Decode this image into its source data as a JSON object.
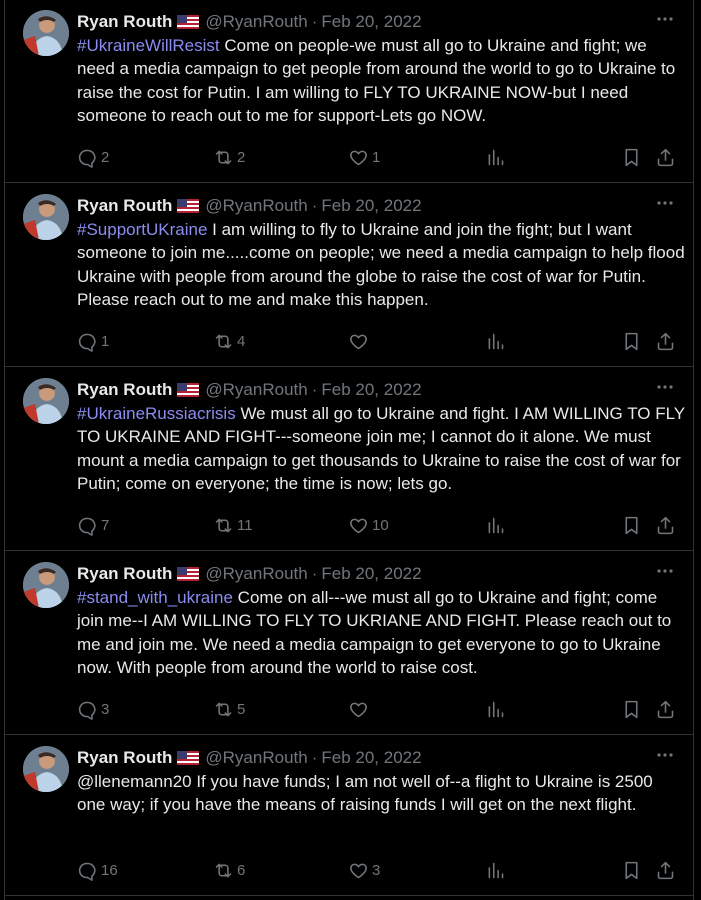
{
  "colors": {
    "background": "#000000",
    "text": "#e7e9ea",
    "muted": "#71767b",
    "hashtag": "#8b8cf0",
    "divider": "#2f3336"
  },
  "tweets": [
    {
      "name": "Ryan Routh",
      "handle": "@RyanRouth",
      "separator": "·",
      "date": "Feb 20, 2022",
      "hashtag": "#UkraineWillResist",
      "text": " Come on people-we must all go to Ukraine and fight; we need a media campaign to get people from around the world to go to Ukraine to raise the cost for Putin. I am willing to FLY TO UKRAINE NOW-but I need someone to reach out to me for support-Lets go NOW.",
      "replies": "2",
      "retweets": "2",
      "likes": "1"
    },
    {
      "name": "Ryan Routh",
      "handle": "@RyanRouth",
      "separator": "·",
      "date": "Feb 20, 2022",
      "hashtag": "#SupportUKraine",
      "text": " I am willing to fly to Ukraine and join the fight; but I want someone to join me.....come on people; we need a media campaign to help flood Ukraine with people from around the globe to raise the cost of war for Putin.  Please reach out to me and make this happen.",
      "replies": "1",
      "retweets": "4",
      "likes": ""
    },
    {
      "name": "Ryan Routh",
      "handle": "@RyanRouth",
      "separator": "·",
      "date": "Feb 20, 2022",
      "hashtag": "#UkraineRussiacrisis",
      "text": " We must all go to Ukraine and fight.  I AM WILLING TO FLY TO UKRAINE AND FIGHT---someone join me; I cannot do it alone.  We must mount a media campaign to get thousands to Ukraine to raise the cost of war for Putin; come on everyone; the time is now; lets go.",
      "replies": "7",
      "retweets": "11",
      "likes": "10"
    },
    {
      "name": "Ryan Routh",
      "handle": "@RyanRouth",
      "separator": "·",
      "date": "Feb 20, 2022",
      "hashtag": "#stand_with_ukraine",
      "text": " Come on all---we must all go to Ukraine and fight; come join me--I AM WILLING TO FLY TO UKRIANE AND FIGHT.  Please reach out to me and join me.  We need a media campaign to get everyone to go to Ukraine now.  With people from around the world to raise cost.",
      "replies": "3",
      "retweets": "5",
      "likes": ""
    },
    {
      "name": "Ryan Routh",
      "handle": "@RyanRouth",
      "separator": "·",
      "date": "Feb 20, 2022",
      "hashtag": "",
      "text": "@llenemann20 If you have funds; I am not well of--a flight to Ukraine is 2500 one way; if you have the means of raising funds I will get on the next flight.",
      "replies": "16",
      "retweets": "6",
      "likes": "3"
    }
  ]
}
